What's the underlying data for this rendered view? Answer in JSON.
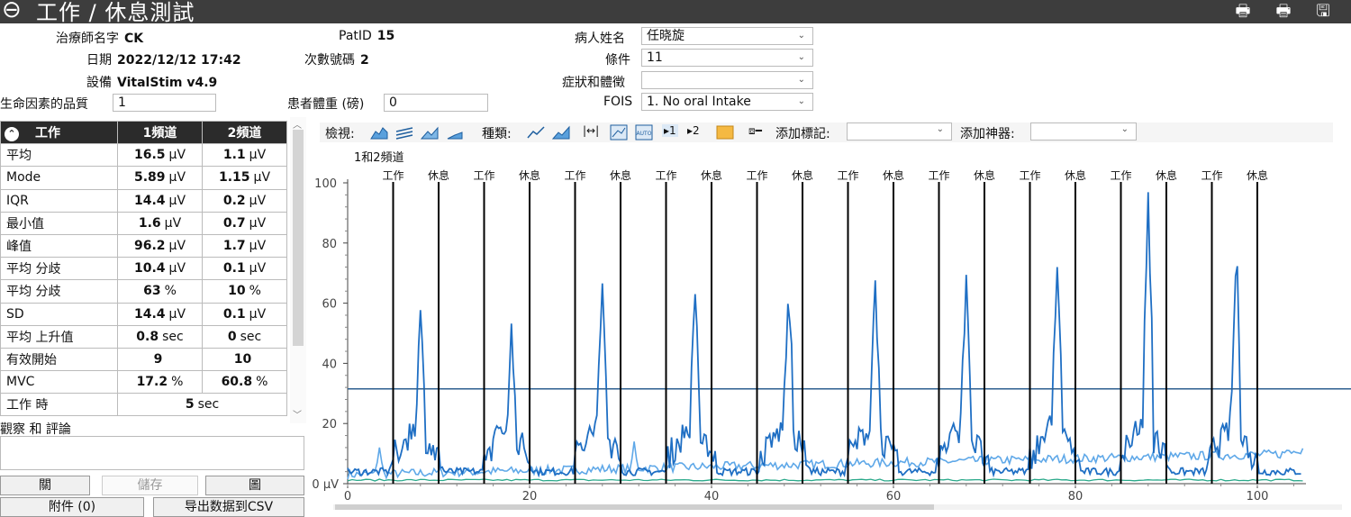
{
  "window": {
    "title": "工作 / 休息測試",
    "back_icon": "arrow-left-circle-icon",
    "icons": [
      "print-icon",
      "print-preview-icon",
      "save-disk-icon"
    ]
  },
  "session": {
    "therapist_label": "治療師名字",
    "therapist_value": "CK",
    "patid_label": "PatID",
    "patid_value": "15",
    "patient_name_label": "病人姓名",
    "patient_name_value": "任晓旋",
    "date_label": "日期",
    "date_value": "2022/12/12 17:42",
    "session_no_label": "次數號碼",
    "session_no_value": "2",
    "condition_label": "條件",
    "condition_value": "11",
    "device_label": "設備",
    "device_value": "VitalStim v4.9",
    "symptoms_label": "症狀和體徵",
    "symptoms_value": "",
    "quality_label": "生命因素的品質",
    "quality_value": "1",
    "weight_label": "患者體重 (磅)",
    "weight_value": "0",
    "fois_label": "FOIS",
    "fois_value": "1. No oral Intake"
  },
  "stats": {
    "header": [
      "工作",
      "1頻道",
      "2頻道"
    ],
    "rows": [
      {
        "label": "平均",
        "c1": "16.5",
        "u1": "µV",
        "c2": "1.1",
        "u2": "µV"
      },
      {
        "label": "Mode",
        "c1": "5.89",
        "u1": "µV",
        "c2": "1.15",
        "u2": "µV"
      },
      {
        "label": "IQR",
        "c1": "14.4",
        "u1": "µV",
        "c2": "0.2",
        "u2": "µV"
      },
      {
        "label": "最小值",
        "c1": "1.6",
        "u1": "µV",
        "c2": "0.7",
        "u2": "µV"
      },
      {
        "label": "峰值",
        "c1": "96.2",
        "u1": "µV",
        "c2": "1.7",
        "u2": "µV"
      },
      {
        "label": "平均 分歧",
        "c1": "10.4",
        "u1": "µV",
        "c2": "0.1",
        "u2": "µV"
      },
      {
        "label": "平均 分歧",
        "c1": "63",
        "u1": "%",
        "c2": "10",
        "u2": "%"
      },
      {
        "label": "SD",
        "c1": "14.4",
        "u1": "µV",
        "c2": "0.1",
        "u2": "µV"
      },
      {
        "label": "平均 上升值",
        "c1": "0.8",
        "u1": "sec",
        "c2": "0",
        "u2": "sec"
      },
      {
        "label": "有效開始",
        "c1": "9",
        "u1": "",
        "c2": "10",
        "u2": ""
      },
      {
        "label": "MVC",
        "c1": "17.2",
        "u1": "%",
        "c2": "60.8",
        "u2": "%"
      }
    ],
    "work_time_label": "工作 時",
    "work_time_value": "5",
    "work_time_unit": "sec"
  },
  "notes": {
    "label": "觀察 和 評論",
    "value": ""
  },
  "buttons": {
    "close": "關",
    "save": "儲存",
    "graph": "圖",
    "attachments": "附件 (0)",
    "export_csv": "导出数据到CSV"
  },
  "toolbar": {
    "view_label": "檢視:",
    "type_label": "種類:",
    "ch1_label": "1",
    "ch2_label": "2",
    "add_marker_label": "添加標記:",
    "add_marker_value": "",
    "add_device_label": "添加神器:",
    "add_device_value": ""
  },
  "chart_title": "1和2頻道",
  "chart_data": {
    "type": "line",
    "title": "1和2頻道",
    "xlabel": "",
    "ylabel": "",
    "xlim": [
      0,
      105
    ],
    "ylim": [
      0,
      100
    ],
    "y_unit_label": "µV",
    "x_ticks": [
      0,
      20,
      40,
      60,
      80,
      100
    ],
    "y_ticks": [
      0,
      20,
      40,
      60,
      80,
      100
    ],
    "threshold": 31.5,
    "markers": [
      {
        "x": 5,
        "label": "工作"
      },
      {
        "x": 10,
        "label": "休息"
      },
      {
        "x": 15,
        "label": "工作"
      },
      {
        "x": 20,
        "label": "休息"
      },
      {
        "x": 25,
        "label": "工作"
      },
      {
        "x": 30,
        "label": "休息"
      },
      {
        "x": 35,
        "label": "工作"
      },
      {
        "x": 40,
        "label": "休息"
      },
      {
        "x": 45,
        "label": "工作"
      },
      {
        "x": 50,
        "label": "休息"
      },
      {
        "x": 55,
        "label": "工作"
      },
      {
        "x": 60,
        "label": "休息"
      },
      {
        "x": 65,
        "label": "工作"
      },
      {
        "x": 70,
        "label": "休息"
      },
      {
        "x": 75,
        "label": "工作"
      },
      {
        "x": 80,
        "label": "休息"
      },
      {
        "x": 85,
        "label": "工作"
      },
      {
        "x": 90,
        "label": "休息"
      },
      {
        "x": 95,
        "label": "工作"
      },
      {
        "x": 100,
        "label": "休息"
      }
    ],
    "series": [
      {
        "color": "#1f6fc4",
        "peaks": [
          {
            "x": 8.0,
            "y": 56
          },
          {
            "x": 18.0,
            "y": 50
          },
          {
            "x": 28.0,
            "y": 66
          },
          {
            "x": 38.2,
            "y": 62
          },
          {
            "x": 48.5,
            "y": 65
          },
          {
            "x": 58.0,
            "y": 68
          },
          {
            "x": 68.0,
            "y": 70
          },
          {
            "x": 78.0,
            "y": 76
          },
          {
            "x": 88.0,
            "y": 96
          },
          {
            "x": 97.7,
            "y": 76
          }
        ],
        "baseline": 4
      },
      {
        "color": "#5fa8e8",
        "peaks": [
          {
            "x": 3.5,
            "y": 12
          },
          {
            "x": 31.5,
            "y": 14
          }
        ],
        "baseline_start": 3,
        "baseline_end": 10,
        "end_value": 11
      },
      {
        "color": "#2aa98a",
        "baseline": 1.2
      }
    ]
  }
}
